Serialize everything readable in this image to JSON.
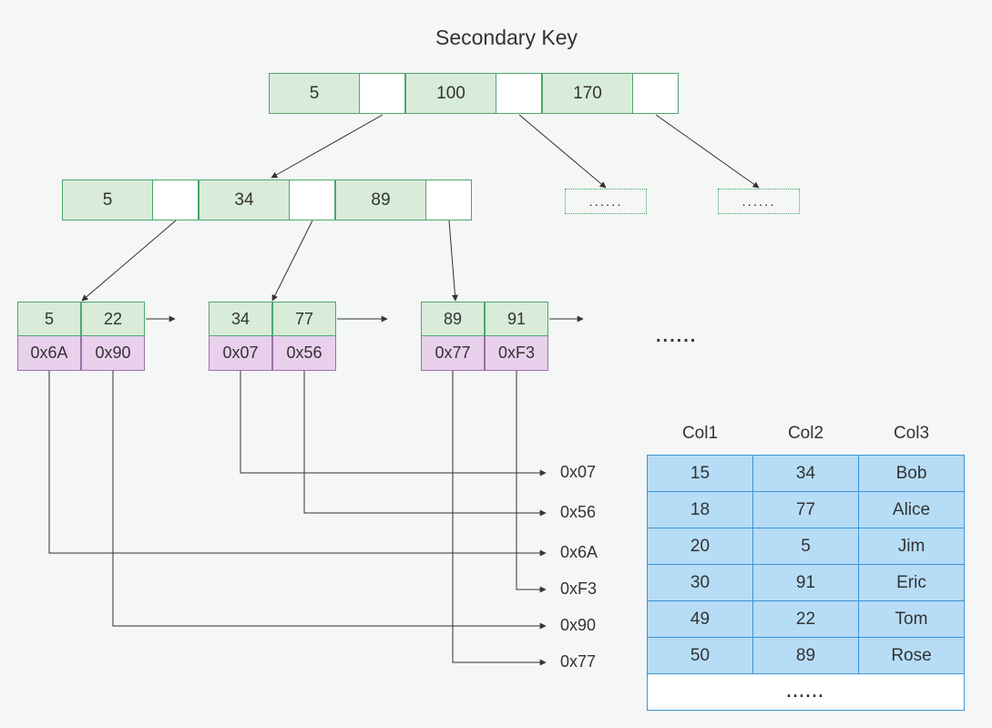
{
  "title": "Secondary Key",
  "root": {
    "keys": [
      "5",
      "100",
      "170"
    ]
  },
  "internal": {
    "keys": [
      "5",
      "34",
      "89"
    ]
  },
  "placeholders": {
    "more": "......"
  },
  "leaves": [
    {
      "keys": [
        "5",
        "22"
      ],
      "ptrs": [
        "0x6A",
        "0x90"
      ]
    },
    {
      "keys": [
        "34",
        "77"
      ],
      "ptrs": [
        "0x07",
        "0x56"
      ]
    },
    {
      "keys": [
        "89",
        "91"
      ],
      "ptrs": [
        "0x77",
        "0xF3"
      ]
    }
  ],
  "leaf_ellipsis": "......",
  "addr_labels": [
    "0x07",
    "0x56",
    "0x6A",
    "0xF3",
    "0x90",
    "0x77"
  ],
  "table": {
    "headers": [
      "Col1",
      "Col2",
      "Col3"
    ],
    "rows": [
      [
        "15",
        "34",
        "Bob"
      ],
      [
        "18",
        "77",
        "Alice"
      ],
      [
        "20",
        "5",
        "Jim"
      ],
      [
        "30",
        "91",
        "Eric"
      ],
      [
        "49",
        "22",
        "Tom"
      ],
      [
        "50",
        "89",
        "Rose"
      ]
    ],
    "footer": "......"
  }
}
